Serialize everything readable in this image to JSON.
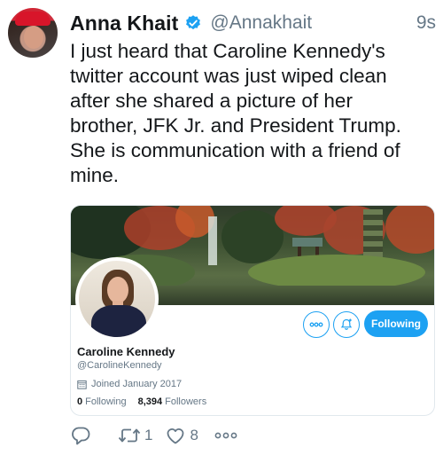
{
  "tweet": {
    "display_name": "Anna Khait",
    "handle": "@Annakhait",
    "time": "9s",
    "text": "I just heard that Caroline Kennedy's\ntwitter account was just wiped clean\nafter she shared a picture of her\nbrother, JFK Jr. and President Trump.\nShe is communication with a friend of\nmine.",
    "verified_icon": "verified-badge-icon",
    "accent_color": "#1da1f2"
  },
  "card": {
    "name": "Caroline Kennedy",
    "handle": "@CarolineKennedy",
    "joined": "Joined January 2017",
    "following_count": "0",
    "following_label": "Following",
    "followers_count": "8,394",
    "followers_label": "Followers",
    "follow_button_label": "Following",
    "more_icon": "more-icon",
    "notify_icon": "notification-bell-icon"
  },
  "actions": {
    "reply_icon": "reply-icon",
    "retweet_icon": "retweet-icon",
    "retweet_count": "1",
    "like_icon": "heart-icon",
    "like_count": "8",
    "more_icon": "more-icon"
  }
}
